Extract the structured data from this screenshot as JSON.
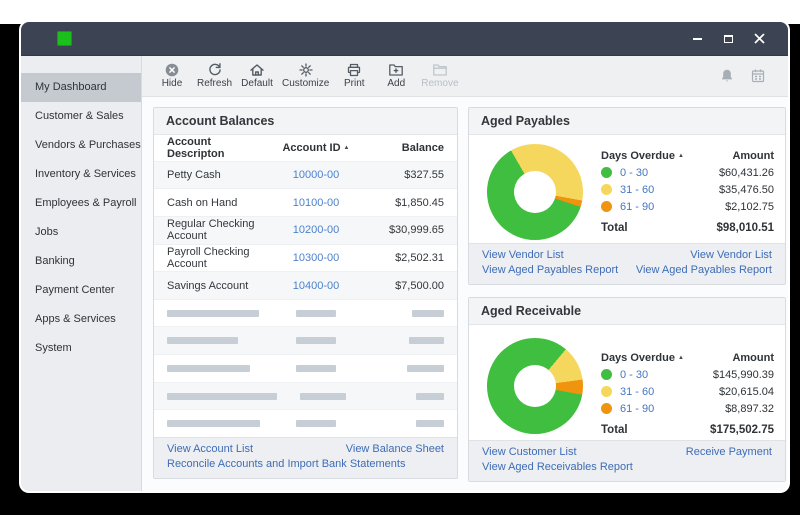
{
  "icons": {
    "sort_asc": "▲"
  },
  "sidebar": {
    "items": [
      {
        "label": "My Dashboard",
        "active": true
      },
      {
        "label": "Customer & Sales"
      },
      {
        "label": "Vendors & Purchases"
      },
      {
        "label": "Inventory & Services"
      },
      {
        "label": "Employees & Payroll"
      },
      {
        "label": "Jobs"
      },
      {
        "label": "Banking"
      },
      {
        "label": "Payment Center"
      },
      {
        "label": "Apps & Services"
      },
      {
        "label": "System"
      }
    ]
  },
  "toolbar": {
    "items": [
      {
        "label": "Hide"
      },
      {
        "label": "Refresh"
      },
      {
        "label": "Default"
      },
      {
        "label": "Customize"
      },
      {
        "label": "Print"
      },
      {
        "label": "Add"
      },
      {
        "label": "Remove",
        "disabled": true
      }
    ]
  },
  "account_balances": {
    "title": "Account Balances",
    "col_description": "Account Descripton",
    "col_account_id": "Account ID",
    "col_balance": "Balance",
    "rows": [
      {
        "desc": "Petty Cash",
        "id": "10000-00",
        "balance": "$327.55"
      },
      {
        "desc": "Cash on Hand",
        "id": "10100-00",
        "balance": "$1,850.45"
      },
      {
        "desc": "Regular Checking Account",
        "id": "10200-00",
        "balance": "$30,999.65"
      },
      {
        "desc": "Payroll Checking Account",
        "id": "10300-00",
        "balance": "$2,502.31"
      },
      {
        "desc": "Savings Account",
        "id": "10400-00",
        "balance": "$7,500.00"
      }
    ],
    "footer": {
      "view_account_list": "View Account List",
      "view_balance_sheet": "View Balance Sheet",
      "reconcile": "Reconcile Accounts and Import Bank Statements"
    }
  },
  "aged_payables": {
    "title": "Aged Payables",
    "legend_header_left": "Days Overdue",
    "legend_header_right": "Amount",
    "total_text": "Total",
    "footer": {
      "left1": "View Vendor List",
      "right1": "View Vendor List",
      "left2": "View Aged Payables Report",
      "right2": "View Aged Payables Report"
    }
  },
  "aged_receivable": {
    "title": "Aged Receivable",
    "legend_header_left": "Days Overdue",
    "legend_header_right": "Amount",
    "total_text": "Total",
    "footer": {
      "left1": "View Customer List",
      "right1": "Receive Payment",
      "left2": "View Aged Receivables Report"
    }
  },
  "chart_data": [
    {
      "id": "aged-payables",
      "type": "pie",
      "donut": true,
      "title": "Aged Payables",
      "categories": [
        "0 - 30",
        "31 - 60",
        "61 - 90"
      ],
      "values": [
        60431.26,
        35476.5,
        2102.75
      ],
      "amount_labels": [
        "$60,431.26",
        "$35,476.50",
        "$2,102.75"
      ],
      "total": 98010.51,
      "total_label": "$98,010.51",
      "colors": [
        "#3fbe3f",
        "#f6d75e",
        "#f0930e"
      ],
      "legend_position": "right"
    },
    {
      "id": "aged-receivable",
      "type": "pie",
      "donut": true,
      "title": "Aged Receivable",
      "categories": [
        "0 - 30",
        "31 - 60",
        "61 - 90"
      ],
      "values": [
        145990.39,
        20615.04,
        8897.32
      ],
      "amount_labels": [
        "$145,990.39",
        "$20,615.04",
        "$8,897.32"
      ],
      "total": 175502.75,
      "total_label": "$175,502.75",
      "colors": [
        "#3fbe3f",
        "#f6d75e",
        "#f0930e"
      ],
      "legend_position": "right"
    }
  ]
}
